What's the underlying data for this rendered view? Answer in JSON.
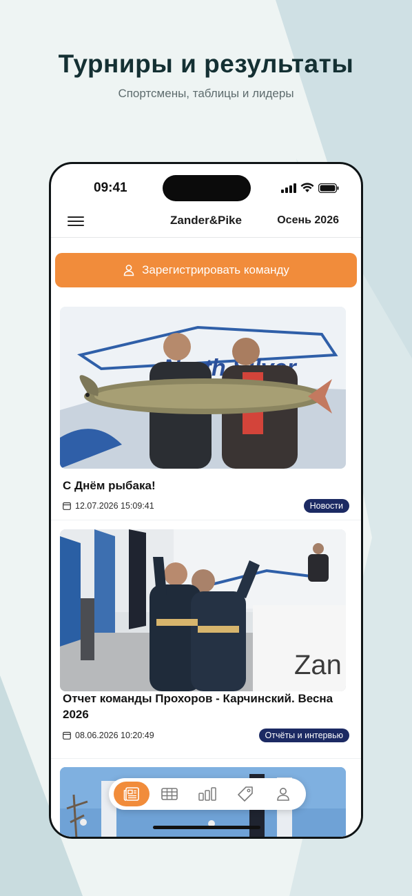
{
  "promo": {
    "title": "Турниры и результаты",
    "subtitle": "Спортсмены, таблицы и лидеры"
  },
  "status_bar": {
    "time": "09:41"
  },
  "header": {
    "app_name": "Zander&Pike",
    "season": "Осень 2026"
  },
  "register": {
    "label": "Зарегистрировать команду",
    "icon": "user-icon"
  },
  "news": [
    {
      "title": "С Днём рыбака!",
      "date": "12.07.2026 15:09:41",
      "tag": "Новости",
      "image": "two anglers holding a large pike"
    },
    {
      "title": "Отчет команды Прохоров - Карчинский. Весна 2026",
      "date": "08.06.2026 10:20:49",
      "tag": "Отчёты и интервью",
      "image": "two anglers celebrating with raised arms"
    },
    {
      "title": "",
      "date": "",
      "tag": "",
      "image": "tournament flags and banners"
    }
  ],
  "tabbar": {
    "tabs": [
      {
        "icon": "news-icon",
        "active": true
      },
      {
        "icon": "table-icon",
        "active": false
      },
      {
        "icon": "chart-icon",
        "active": false
      },
      {
        "icon": "tag-icon",
        "active": false
      },
      {
        "icon": "profile-icon",
        "active": false
      }
    ]
  },
  "colors": {
    "accent": "#f18c3b",
    "tag_bg": "#1c2a63",
    "heading": "#143033"
  }
}
